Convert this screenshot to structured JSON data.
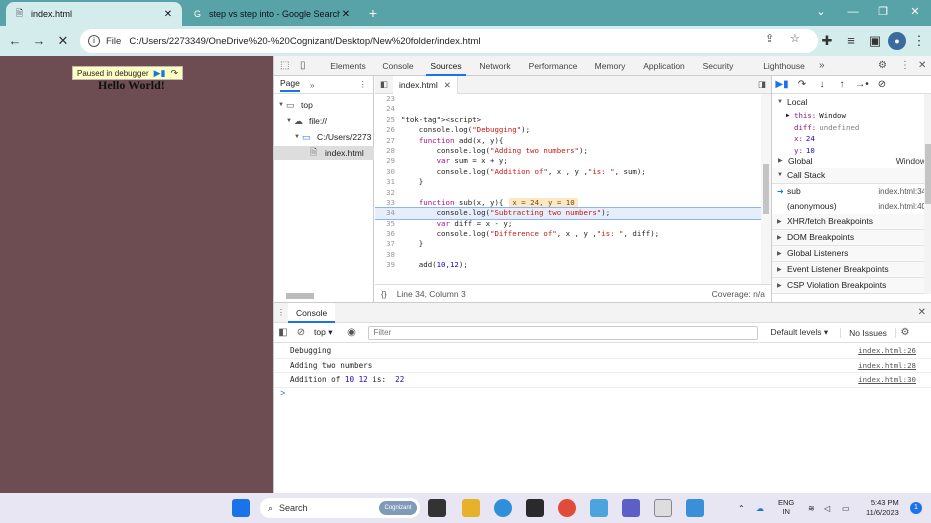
{
  "browser": {
    "tabs": [
      {
        "title": "index.html",
        "active": true
      },
      {
        "title": "step vs step into - Google Search",
        "active": false
      }
    ],
    "new_tab_glyph": "+",
    "nav": {
      "back": "←",
      "forward": "→",
      "stop": "✕"
    },
    "scheme_label": "File",
    "url": "C:/Users/2273349/OneDrive%20-%20Cognizant/Desktop/New%20folder/index.html"
  },
  "page": {
    "paused_label": "Paused in debugger",
    "heading": "Hello World!"
  },
  "devtools": {
    "tabs": [
      "Elements",
      "Console",
      "Sources",
      "Network",
      "Performance",
      "Memory",
      "Application",
      "Security",
      "Lighthouse"
    ],
    "active_tab": "Sources",
    "navigator": {
      "tab": "Page",
      "tree": [
        {
          "label": "top",
          "depth": 0
        },
        {
          "label": "file://",
          "depth": 1
        },
        {
          "label": "C:/Users/2273",
          "depth": 2
        },
        {
          "label": "index.html",
          "depth": 3
        }
      ]
    },
    "editor": {
      "file_tab": "index.html",
      "status_position": "Line 34, Column 3",
      "coverage": "Coverage: n/a",
      "inline_value": "x = 24, y = 10",
      "lines": [
        {
          "n": "23",
          "code": ""
        },
        {
          "n": "24",
          "code": ""
        },
        {
          "n": "25",
          "code": "<script>"
        },
        {
          "n": "26",
          "code": "    console.log(\"Debugging\");"
        },
        {
          "n": "27",
          "code": "    function add(x, y){"
        },
        {
          "n": "28",
          "code": "        console.log(\"Adding two numbers\");"
        },
        {
          "n": "29",
          "code": "        var sum = x + y;"
        },
        {
          "n": "30",
          "code": "        console.log(\"Addition of\", x , y ,\"is: \", sum);"
        },
        {
          "n": "31",
          "code": "    }"
        },
        {
          "n": "32",
          "code": ""
        },
        {
          "n": "33",
          "code": "    function sub(x, y){"
        },
        {
          "n": "34",
          "code": "        console.log(\"Subtracting two numbers\");"
        },
        {
          "n": "35",
          "code": "        var diff = x - y;"
        },
        {
          "n": "36",
          "code": "        console.log(\"Difference of\", x , y ,\"is: \", diff);"
        },
        {
          "n": "37",
          "code": "    }"
        },
        {
          "n": "38",
          "code": ""
        },
        {
          "n": "39",
          "code": "    add(10,12);"
        }
      ]
    },
    "scope": {
      "local_label": "Local",
      "this_key": "this:",
      "this_val": "Window",
      "vars": [
        {
          "k": "diff:",
          "v": "undefined"
        },
        {
          "k": "x:",
          "v": "24"
        },
        {
          "k": "y:",
          "v": "10"
        }
      ],
      "global_label": "Global",
      "global_val": "Window"
    },
    "call_stack": {
      "label": "Call Stack",
      "frames": [
        {
          "name": "sub",
          "loc": "index.html:34"
        },
        {
          "name": "(anonymous)",
          "loc": "index.html:40"
        }
      ]
    },
    "sections": [
      "XHR/fetch Breakpoints",
      "DOM Breakpoints",
      "Global Listeners",
      "Event Listener Breakpoints",
      "CSP Violation Breakpoints"
    ],
    "drawer": {
      "tab": "Console",
      "context": "top",
      "filter_placeholder": "Filter",
      "levels": "Default levels",
      "issues": "No Issues",
      "messages": [
        {
          "text": "Debugging",
          "nums": "",
          "src": "index.html:26"
        },
        {
          "text": "Adding two numbers",
          "nums": "",
          "src": "index.html:28"
        },
        {
          "text": "Addition of ",
          "nums": "10 12",
          "tail": " is:  ",
          "result": "22",
          "src": "index.html:30"
        }
      ],
      "prompt": ">"
    }
  },
  "taskbar": {
    "search": "Search",
    "search_chip": "Cognizant",
    "lang_top": "ENG",
    "lang_bottom": "IN",
    "time": "5:43 PM",
    "date": "11/6/2023",
    "notifications": "1"
  },
  "colors": {
    "tabstrip": "#58a3a8",
    "toolbar": "#d4eceb",
    "page_bg": "#6d4d51",
    "accent": "#1a73e8",
    "taskbar": "#e8e6f2"
  }
}
